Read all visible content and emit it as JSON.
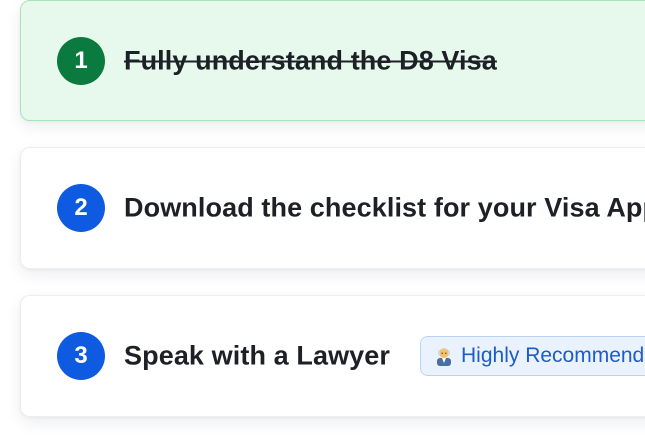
{
  "steps": [
    {
      "number": "1",
      "label": "Fully understand the D8 Visa",
      "status": "completed"
    },
    {
      "number": "2",
      "label": "Download the checklist for your Visa Application",
      "status": "pending"
    },
    {
      "number": "3",
      "label": "Speak with a Lawyer",
      "status": "pending",
      "badge": {
        "icon": "lawyer-emoji-icon",
        "text": "Highly Recommended"
      }
    }
  ],
  "colors": {
    "completed_bg": "#e7f9ec",
    "completed_border": "#a9e4b9",
    "completed_circle": "#0b7a3e",
    "pending_circle": "#0e5ae0",
    "badge_bg": "#eaf2fd",
    "badge_text": "#1c5cc9"
  }
}
